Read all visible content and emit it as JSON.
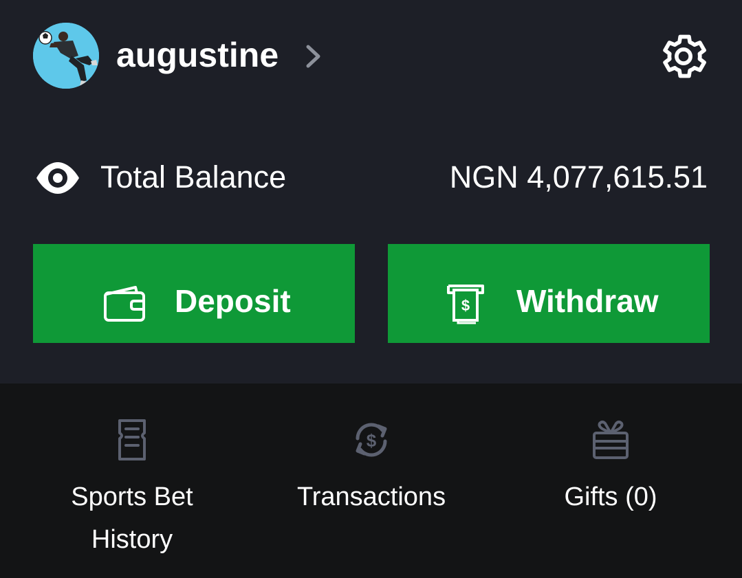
{
  "profile": {
    "username": "augustine",
    "avatar_icon": "soccer-player-avatar",
    "chevron_icon": "chevron-right-icon",
    "settings_icon": "gear-icon"
  },
  "balance": {
    "visibility_icon": "eye-icon",
    "label": "Total Balance",
    "value": "NGN 4,077,615.51"
  },
  "actions": {
    "deposit": {
      "label": "Deposit",
      "icon": "wallet-icon"
    },
    "withdraw": {
      "label": "Withdraw",
      "icon": "cash-withdraw-icon"
    }
  },
  "menu": [
    {
      "label": "Sports Bet History",
      "icon": "receipt-icon"
    },
    {
      "label": "Transactions",
      "icon": "dollar-exchange-icon"
    },
    {
      "label": "Gifts (0)",
      "icon": "gift-icon"
    }
  ],
  "colors": {
    "panel_bg": "#1d1f27",
    "page_bg": "#131415",
    "accent_green": "#0f9937",
    "muted_icon": "#5c6170"
  }
}
